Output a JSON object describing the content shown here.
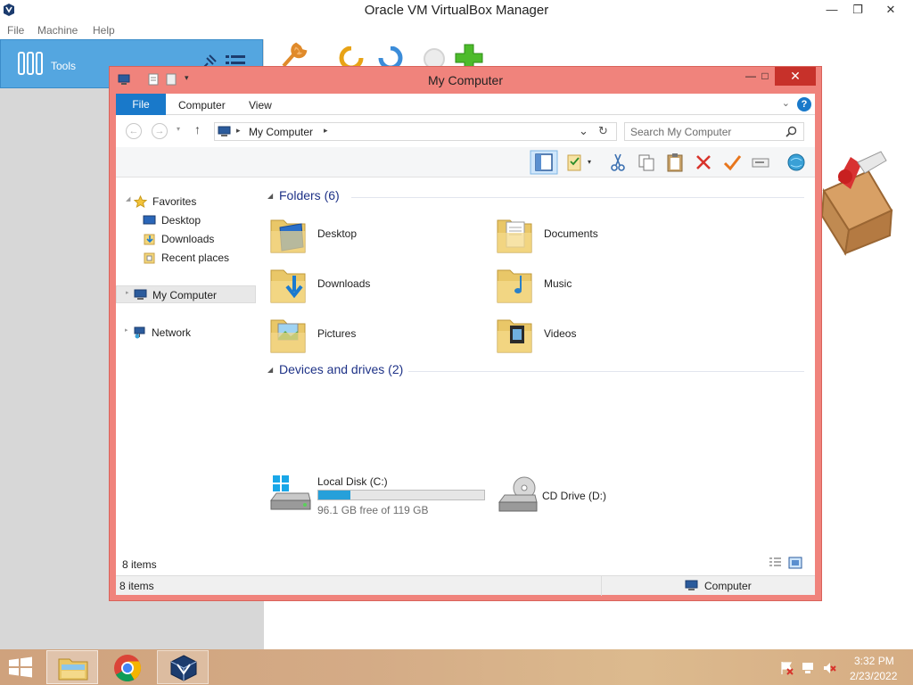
{
  "vbox": {
    "title": "Oracle VM VirtualBox Manager",
    "menu": [
      "File",
      "Machine",
      "Help"
    ],
    "tools_label": "Tools"
  },
  "explorer": {
    "title": "My Computer",
    "ribbon_tabs": {
      "file": "File",
      "computer": "Computer",
      "view": "View"
    },
    "help_label": "?",
    "address_path": "My Computer",
    "search_placeholder": "Search My Computer",
    "nav": {
      "favorites": "Favorites",
      "desktop": "Desktop",
      "downloads": "Downloads",
      "recent_places": "Recent places",
      "my_computer": "My Computer",
      "network": "Network"
    },
    "groups": {
      "folders": "Folders (6)",
      "devices": "Devices and drives (2)"
    },
    "folders": [
      "Desktop",
      "Documents",
      "Downloads",
      "Music",
      "Pictures",
      "Videos"
    ],
    "drive_c": {
      "label": "Local Disk (C:)",
      "free_text": "96.1 GB free of 119 GB",
      "used_fraction": 0.192
    },
    "drive_d": {
      "label": "CD Drive (D:)"
    },
    "item_count": "8 items",
    "status_left": "8 items",
    "status_right": "Computer"
  },
  "taskbar": {
    "time": "3:32 PM",
    "date": "2/23/2022"
  },
  "colors": {
    "window_frame": "#f0837c",
    "accent": "#1979ca",
    "close": "#c7312a",
    "selection": "#54a6e0",
    "folder_header": "#1e3287",
    "progress": "#26a0da"
  }
}
